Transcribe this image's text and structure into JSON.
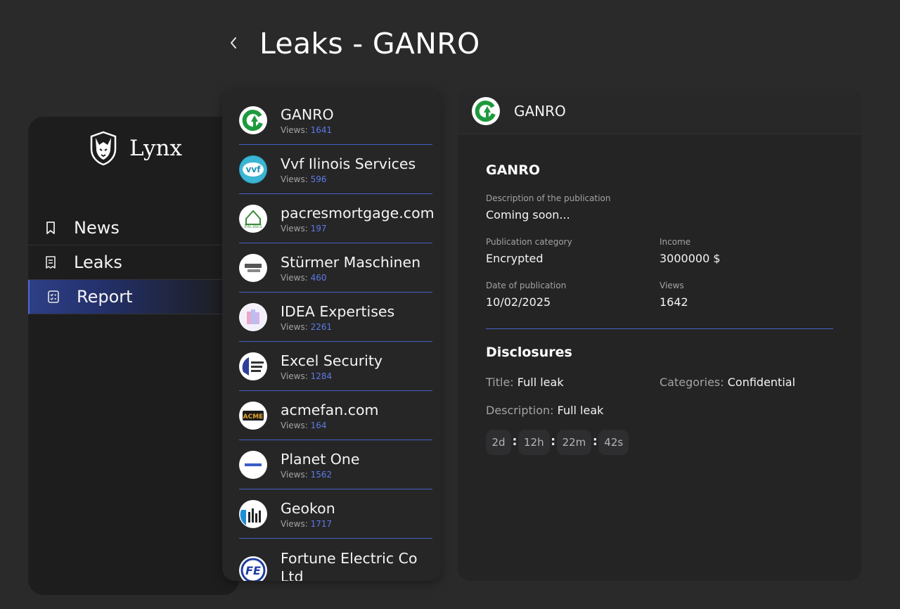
{
  "header": {
    "title": "Leaks - GANRO",
    "back_icon": "chevron-left-icon"
  },
  "sidebar": {
    "brand": "Lynx",
    "logo_icon": "lynx-shield-icon",
    "items": [
      {
        "label": "News",
        "icon": "bookmark-icon",
        "active": false
      },
      {
        "label": "Leaks",
        "icon": "receipt-icon",
        "active": false
      },
      {
        "label": "Report",
        "icon": "checklist-icon",
        "active": true
      }
    ]
  },
  "list": {
    "views_label": "Views:",
    "items": [
      {
        "name": "GANRO",
        "views": "1641"
      },
      {
        "name": "Vvf Ilinois Services",
        "views": "596"
      },
      {
        "name": "pacresmortgage.com",
        "views": "197"
      },
      {
        "name": "Stürmer Maschinen",
        "views": "460"
      },
      {
        "name": "IDEA Expertises",
        "views": "2261"
      },
      {
        "name": "Excel Security",
        "views": "1284"
      },
      {
        "name": "acmefan.com",
        "views": "164"
      },
      {
        "name": "Planet One",
        "views": "1562"
      },
      {
        "name": "Geokon",
        "views": "1717"
      },
      {
        "name": "Fortune Electric Co Ltd",
        "views": ""
      }
    ]
  },
  "detail": {
    "company": "GANRO",
    "title": "GANRO",
    "description_label": "Description of the publication",
    "description": "Coming soon...",
    "category_label": "Publication category",
    "category": "Encrypted",
    "income_label": "Income",
    "income": "3000000 $",
    "date_label": "Date of publication",
    "date": "10/02/2025",
    "views_label": "Views",
    "views": "1642",
    "disclosures": {
      "heading": "Disclosures",
      "title_label": "Title:",
      "title": "Full leak",
      "categories_label": "Categories:",
      "categories": "Confidential",
      "description_label": "Description:",
      "description": "Full leak"
    },
    "timer": {
      "days": "2d",
      "hours": "12h",
      "minutes": "22m",
      "seconds": "42s",
      "separator": ":"
    }
  },
  "colors": {
    "background": "#2a2a2b",
    "sidebar": "#1d1d1e",
    "accent": "#4561c4",
    "views_number": "#5d7ae6",
    "ganro_green": "#1e9a3e"
  }
}
